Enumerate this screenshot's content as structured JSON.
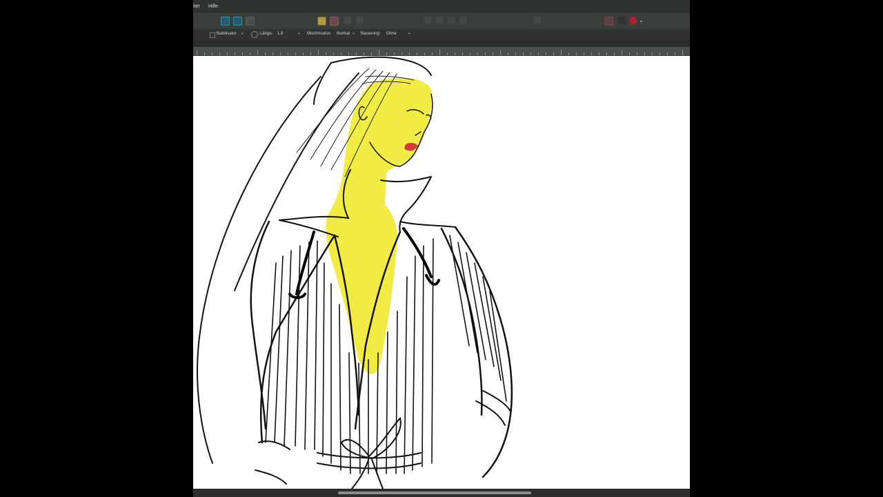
{
  "app": {
    "menu": {
      "item_partial": "iter",
      "help": "Hilfe"
    },
    "options": {
      "stabilizer_label": "Stabilisator",
      "length_label": "Länge:",
      "length_value": "1,9",
      "blend_label": "Mischmodus:",
      "blend_value": "Normal",
      "control_label": "Steuerung:",
      "control_value": "Ohne"
    },
    "toolbar": {
      "icons": [
        "select-rectangle-icon",
        "select-lasso-icon",
        "transform-icon",
        "layer-group-icon",
        "layer-add-icon",
        "color-swatch-icon"
      ]
    },
    "canvas": {
      "subject": "fashion sketch of woman in pinstriped trench coat",
      "colors": {
        "skin_highlight": "#f0ea2a",
        "lips": "#d83a3a",
        "ink": "#111111",
        "paper": "#ffffff"
      }
    }
  }
}
